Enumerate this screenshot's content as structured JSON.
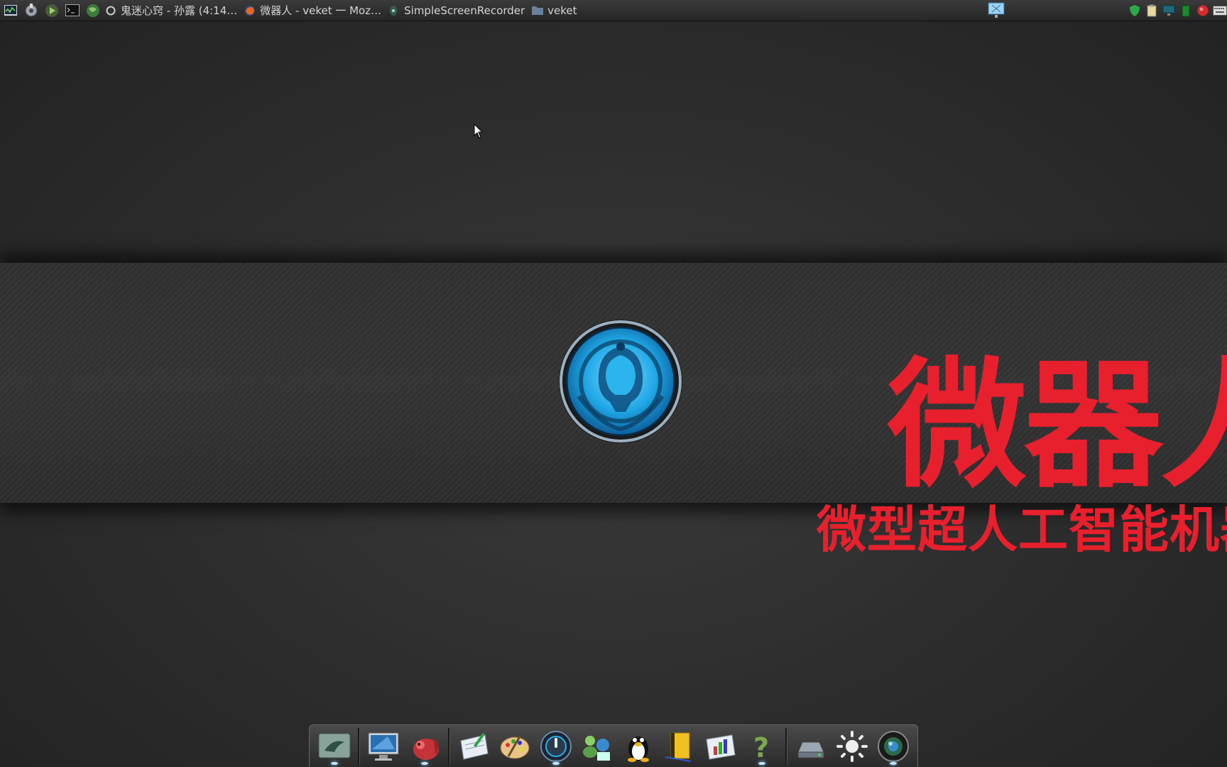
{
  "taskbar": {
    "launchers": [
      "system-monitor-icon",
      "tools-icon",
      "media-player-icon",
      "terminal-icon",
      "globe-icon",
      "record-icon"
    ],
    "tasks": [
      {
        "title": "鬼迷心窍 - 孙露 (4:14…",
        "icon": "music-icon"
      },
      {
        "title": "微器人 - veket 一 Moz…",
        "icon": "firefox-icon"
      },
      {
        "title": "SimpleScreenRecorder",
        "icon": "recorder-icon"
      },
      {
        "title": "veket",
        "icon": "folder-icon"
      }
    ],
    "tray": [
      "shield-icon",
      "clipboard-icon",
      "network-icon",
      "battery-icon",
      "power-icon",
      "keyboard-icon"
    ]
  },
  "brand": {
    "title": "微器人",
    "subtitle": "微型超人工智能机器"
  },
  "dock": {
    "items": [
      {
        "icon": "shark-file-manager-icon",
        "running": true
      },
      {
        "icon": "monitor-icon",
        "running": false
      },
      {
        "icon": "squirrel-icon",
        "running": true
      },
      {
        "icon": "text-editor-icon",
        "running": false
      },
      {
        "icon": "paint-palette-icon",
        "running": false
      },
      {
        "icon": "music-player-icon",
        "running": true
      },
      {
        "icon": "users-network-icon",
        "running": false
      },
      {
        "icon": "penguin-qq-icon",
        "running": false
      },
      {
        "icon": "notebook-icon",
        "running": false
      },
      {
        "icon": "spreadsheet-icon",
        "running": false
      },
      {
        "icon": "help-icon",
        "running": true
      },
      {
        "icon": "drive-icon",
        "running": false
      },
      {
        "icon": "settings-sun-icon",
        "running": false
      },
      {
        "icon": "camera-lens-icon",
        "running": true
      }
    ]
  },
  "colors": {
    "brand_red": "#e8202e",
    "logo_blue": "#1fa7e6"
  }
}
